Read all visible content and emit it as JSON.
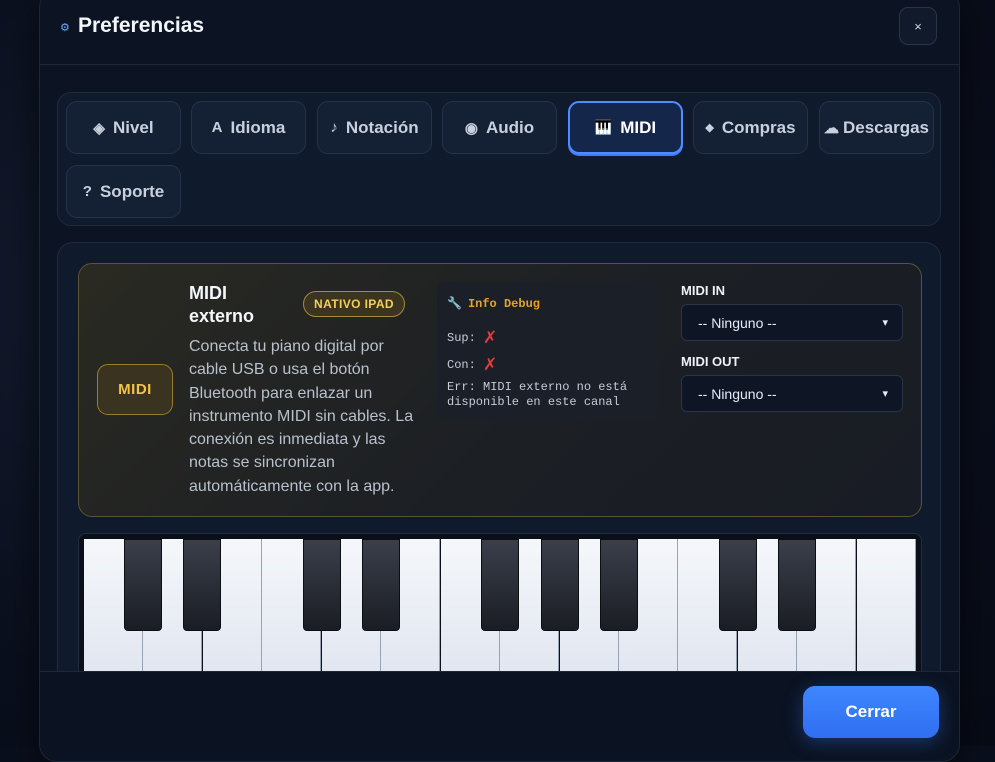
{
  "header": {
    "title": "Preferencias",
    "close_label": "×"
  },
  "tabs": [
    {
      "icon": "◈",
      "label": "Nivel"
    },
    {
      "icon": "A",
      "label": "Idioma"
    },
    {
      "icon": "♪",
      "label": "Notación"
    },
    {
      "icon": "◉",
      "label": "Audio"
    },
    {
      "icon": "🎹",
      "label": "MIDI",
      "active": true
    },
    {
      "icon": "◆",
      "label": "Compras"
    },
    {
      "icon": "☁",
      "label": "Descargas"
    },
    {
      "icon": "?",
      "label": "Soporte"
    }
  ],
  "midi_card": {
    "badge": "MIDI",
    "title": "MIDI externo",
    "tag": "NATIVO IPAD",
    "description": "Conecta tu piano digital por cable USB o usa el botón Bluetooth para enlazar un instrumento MIDI sin cables. La conexión es inmediata y las notas se sincronizan automáticamente con la app.",
    "debug": {
      "title": "Info Debug",
      "sup_label": "Sup:",
      "con_label": "Con:",
      "err": "Err: MIDI externo no está disponible en este canal"
    },
    "midi_in": {
      "label": "MIDI IN",
      "value": "-- Ninguno --"
    },
    "midi_out": {
      "label": "MIDI OUT",
      "value": "-- Ninguno --"
    }
  },
  "colors": {
    "accent": "#3f86ff",
    "gold": "#f2c54a",
    "error": "#e23b3b"
  },
  "footer": {
    "close_button": "Cerrar"
  }
}
